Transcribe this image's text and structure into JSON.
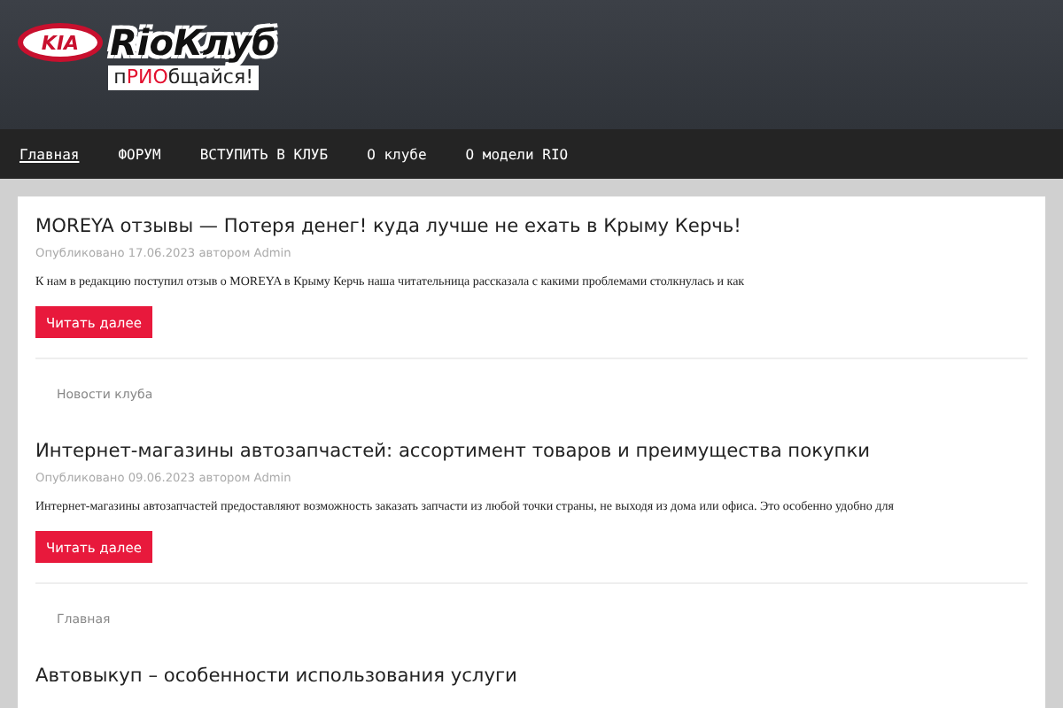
{
  "logo": {
    "badge": "KIA",
    "name": "RioКлуб",
    "tagline": [
      {
        "text": "п",
        "accent": false
      },
      {
        "text": "РИО",
        "accent": true
      },
      {
        "text": "бщайся!",
        "accent": false
      }
    ]
  },
  "nav": [
    {
      "label": "Главная",
      "selected": true
    },
    {
      "label": "ФОРУМ",
      "selected": false
    },
    {
      "label": "ВСТУПИТЬ В КЛУБ",
      "selected": false
    },
    {
      "label": "О клубе",
      "selected": false
    },
    {
      "label": "О модели RIO",
      "selected": false
    }
  ],
  "posts": [
    {
      "title": "MOREYA отзывы — Потеря денег! куда лучше не ехать в Крыму Керчь!",
      "meta": "Опубликовано 17.06.2023 автором Admin",
      "excerpt": "К нам в редакцию поступил отзыв о MOREYA в Крыму Керчь наша читательница рассказала с какими проблемами столкнулась и как",
      "button": "Читать далее",
      "category": "Новости клуба"
    },
    {
      "title": "Интернет-магазины автозапчастей: ассортимент товаров и преимущества покупки",
      "meta": "Опубликовано 09.06.2023 автором Admin",
      "excerpt": "Интернет-магазины автозапчастей предоставляют возможность заказать запчасти из любой точки страны, не выходя из дома или офиса. Это особенно удобно для",
      "button": "Читать далее",
      "category": "Главная"
    },
    {
      "title": "Автовыкуп – особенности использования услуги"
    }
  ]
}
